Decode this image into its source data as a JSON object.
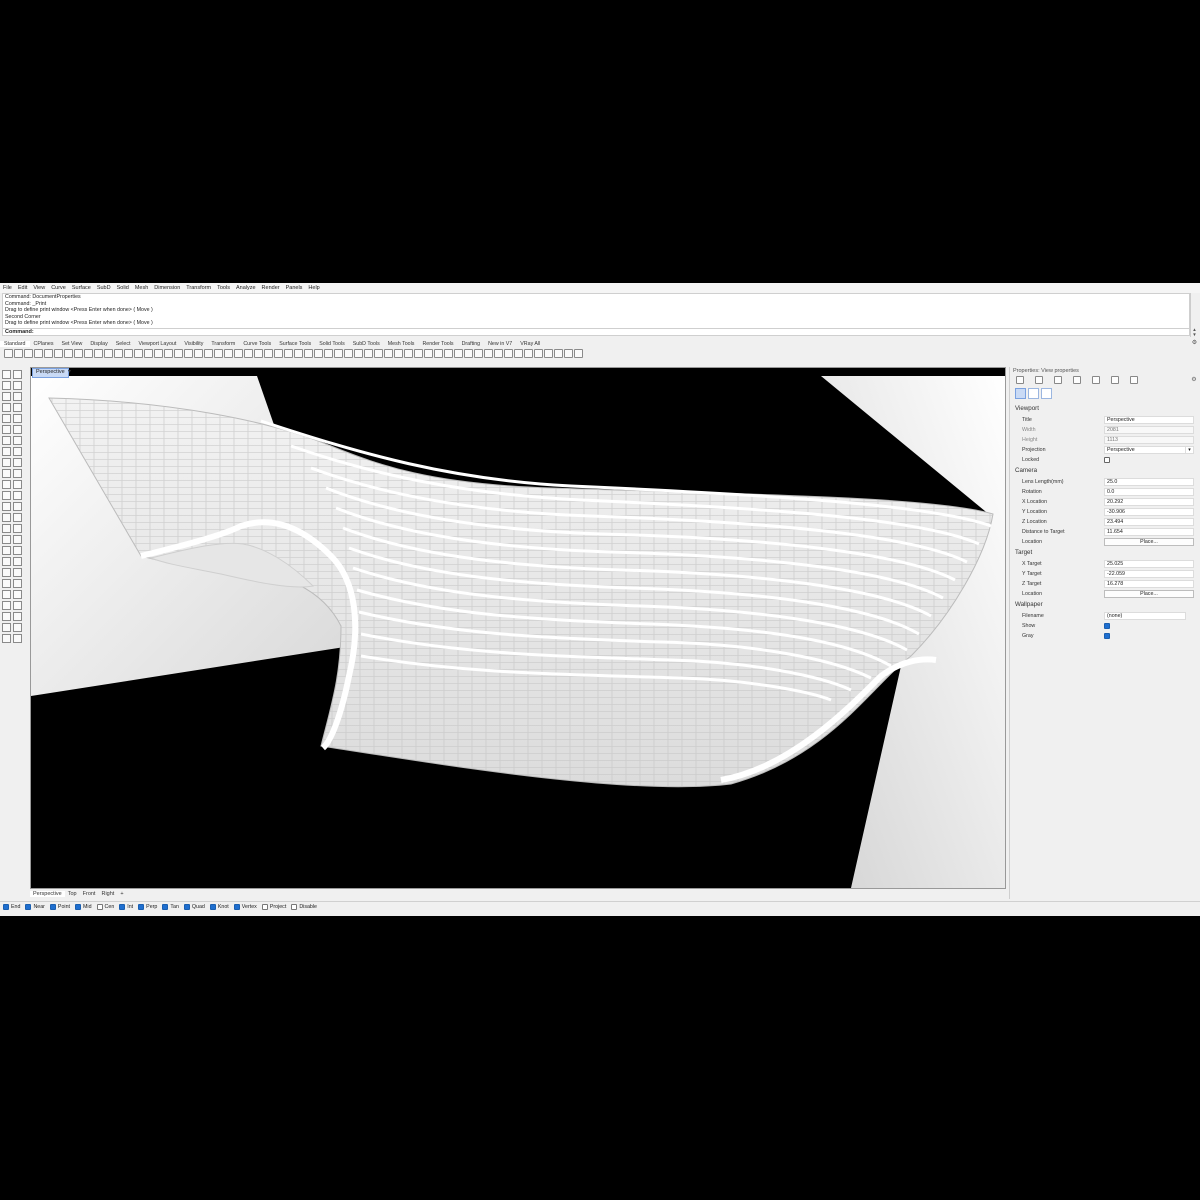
{
  "menu": [
    "File",
    "Edit",
    "View",
    "Curve",
    "Surface",
    "SubD",
    "Solid",
    "Mesh",
    "Dimension",
    "Transform",
    "Tools",
    "Analyze",
    "Render",
    "Panels",
    "Help"
  ],
  "command_history": [
    "Command: DocumentProperties",
    "Command: _Print",
    "Drag to define print window <Press Enter when done> ( Move )",
    "Second Corner",
    "Drag to define print window <Press Enter when done> ( Move )"
  ],
  "command_prompt": "Command:",
  "toolbar_tabs": [
    "Standard",
    "CPlanes",
    "Set View",
    "Display",
    "Select",
    "Viewport Layout",
    "Visibility",
    "Transform",
    "Curve Tools",
    "Surface Tools",
    "Solid Tools",
    "SubD Tools",
    "Mesh Tools",
    "Render Tools",
    "Drafting",
    "New in V7",
    "VRay All"
  ],
  "viewport": {
    "active_tab": "Perspective",
    "tab_menu": "▾"
  },
  "viewport_tabs": [
    "Perspective",
    "Top",
    "Front",
    "Right",
    "+"
  ],
  "osnaps": [
    {
      "label": "End",
      "on": true
    },
    {
      "label": "Near",
      "on": true
    },
    {
      "label": "Point",
      "on": true
    },
    {
      "label": "Mid",
      "on": true
    },
    {
      "label": "Cen",
      "on": false
    },
    {
      "label": "Int",
      "on": true
    },
    {
      "label": "Perp",
      "on": true
    },
    {
      "label": "Tan",
      "on": true
    },
    {
      "label": "Quad",
      "on": true
    },
    {
      "label": "Knot",
      "on": true
    },
    {
      "label": "Vertex",
      "on": true
    },
    {
      "label": "Project",
      "on": false
    },
    {
      "label": "Disable",
      "on": false
    }
  ],
  "properties": {
    "title": "Properties: View properties",
    "viewport_section": "Viewport",
    "vp_title_label": "Title",
    "vp_title": "Perspective",
    "vp_width_label": "Width",
    "vp_width": "2081",
    "vp_height_label": "Height",
    "vp_height": "1113",
    "projection_label": "Projection",
    "projection": "Perspective",
    "locked_label": "Locked",
    "locked": false,
    "camera_section": "Camera",
    "lens_label": "Lens Length(mm)",
    "lens": "25.0",
    "rotation_label": "Rotation",
    "rotation": "0.0",
    "xloc_label": "X Location",
    "xloc": "20.292",
    "yloc_label": "Y Location",
    "yloc": "-30.906",
    "zloc_label": "Z Location",
    "zloc": "23.494",
    "dist_label": "Distance to Target",
    "dist": "11.654",
    "cam_location_label": "Location",
    "place_button": "Place...",
    "target_section": "Target",
    "xt_label": "X Target",
    "xt": "25.025",
    "yt_label": "Y Target",
    "yt": "-22.059",
    "zt_label": "Z Target",
    "zt": "16.278",
    "tgt_location_label": "Location",
    "wallpaper_section": "Wallpaper",
    "filename_label": "Filename",
    "filename": "(none)",
    "browse": "...",
    "show_label": "Show",
    "show": true,
    "gray_label": "Gray",
    "gray": true
  }
}
